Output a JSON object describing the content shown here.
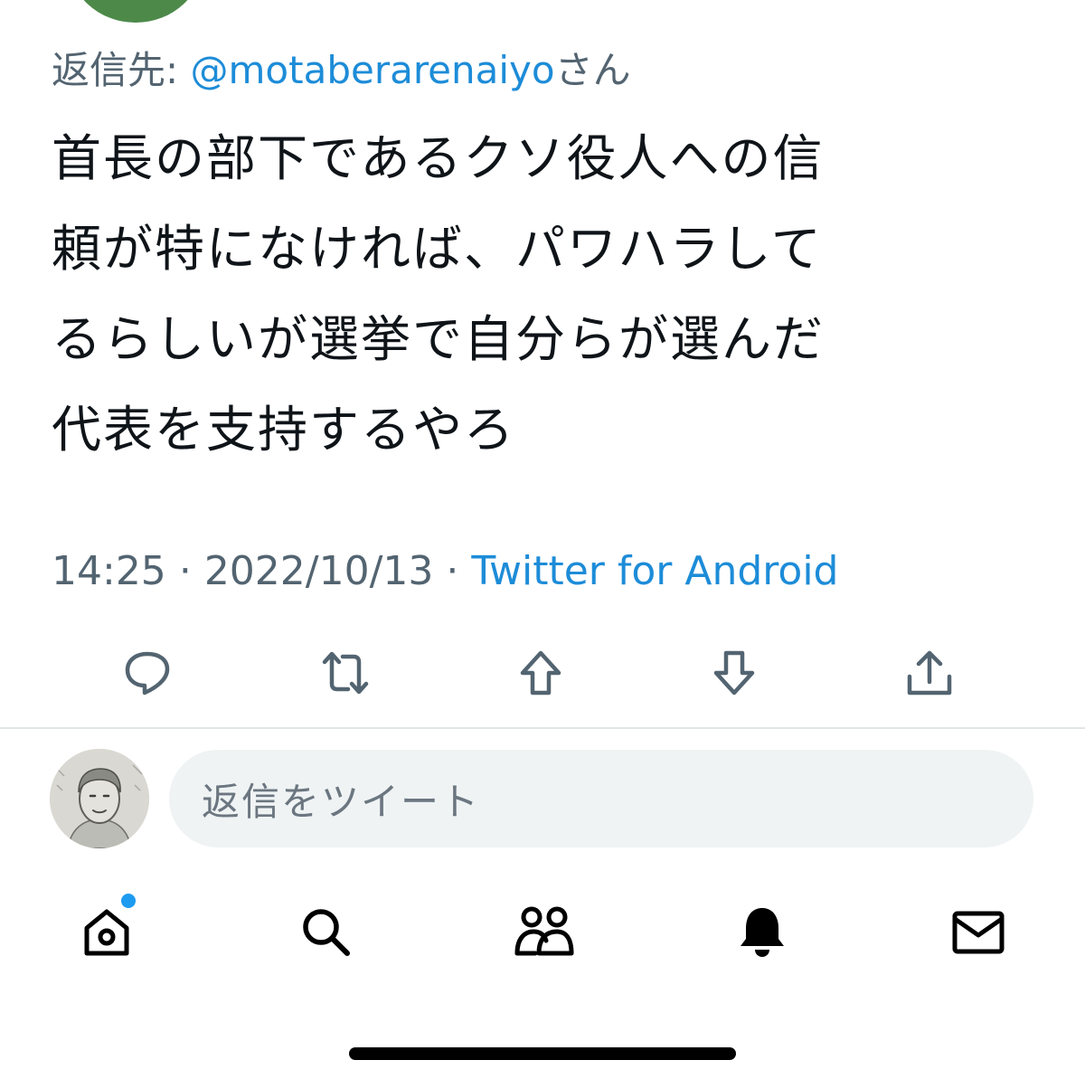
{
  "reply_context": {
    "prefix": "返信先:",
    "handle": "@motaberarenaiyo",
    "suffix": "さん"
  },
  "tweet": {
    "lines": [
      "首長の部下であるクソ役人への信",
      "頼が特になければ、パワハラして",
      "るらしいが選挙で自分らが選んだ",
      "代表を支持するやろ"
    ],
    "time": "14:25",
    "separator": "·",
    "date": "2022/10/13",
    "source": "Twitter for Android"
  },
  "actions": {
    "icons": [
      "reply-icon",
      "retweet-icon",
      "upvote-icon",
      "downvote-icon",
      "share-icon"
    ]
  },
  "reply_composer": {
    "placeholder": "返信をツイート"
  },
  "tabbar": {
    "icons": [
      "home-icon",
      "search-icon",
      "communities-icon",
      "notifications-icon",
      "messages-icon"
    ],
    "home_has_badge": true
  },
  "colors": {
    "link": "#1d8cd8",
    "secondary_text": "#536471",
    "badge": "#1d9bf0",
    "input_bg": "#eff3f4",
    "icon": "#536471"
  }
}
